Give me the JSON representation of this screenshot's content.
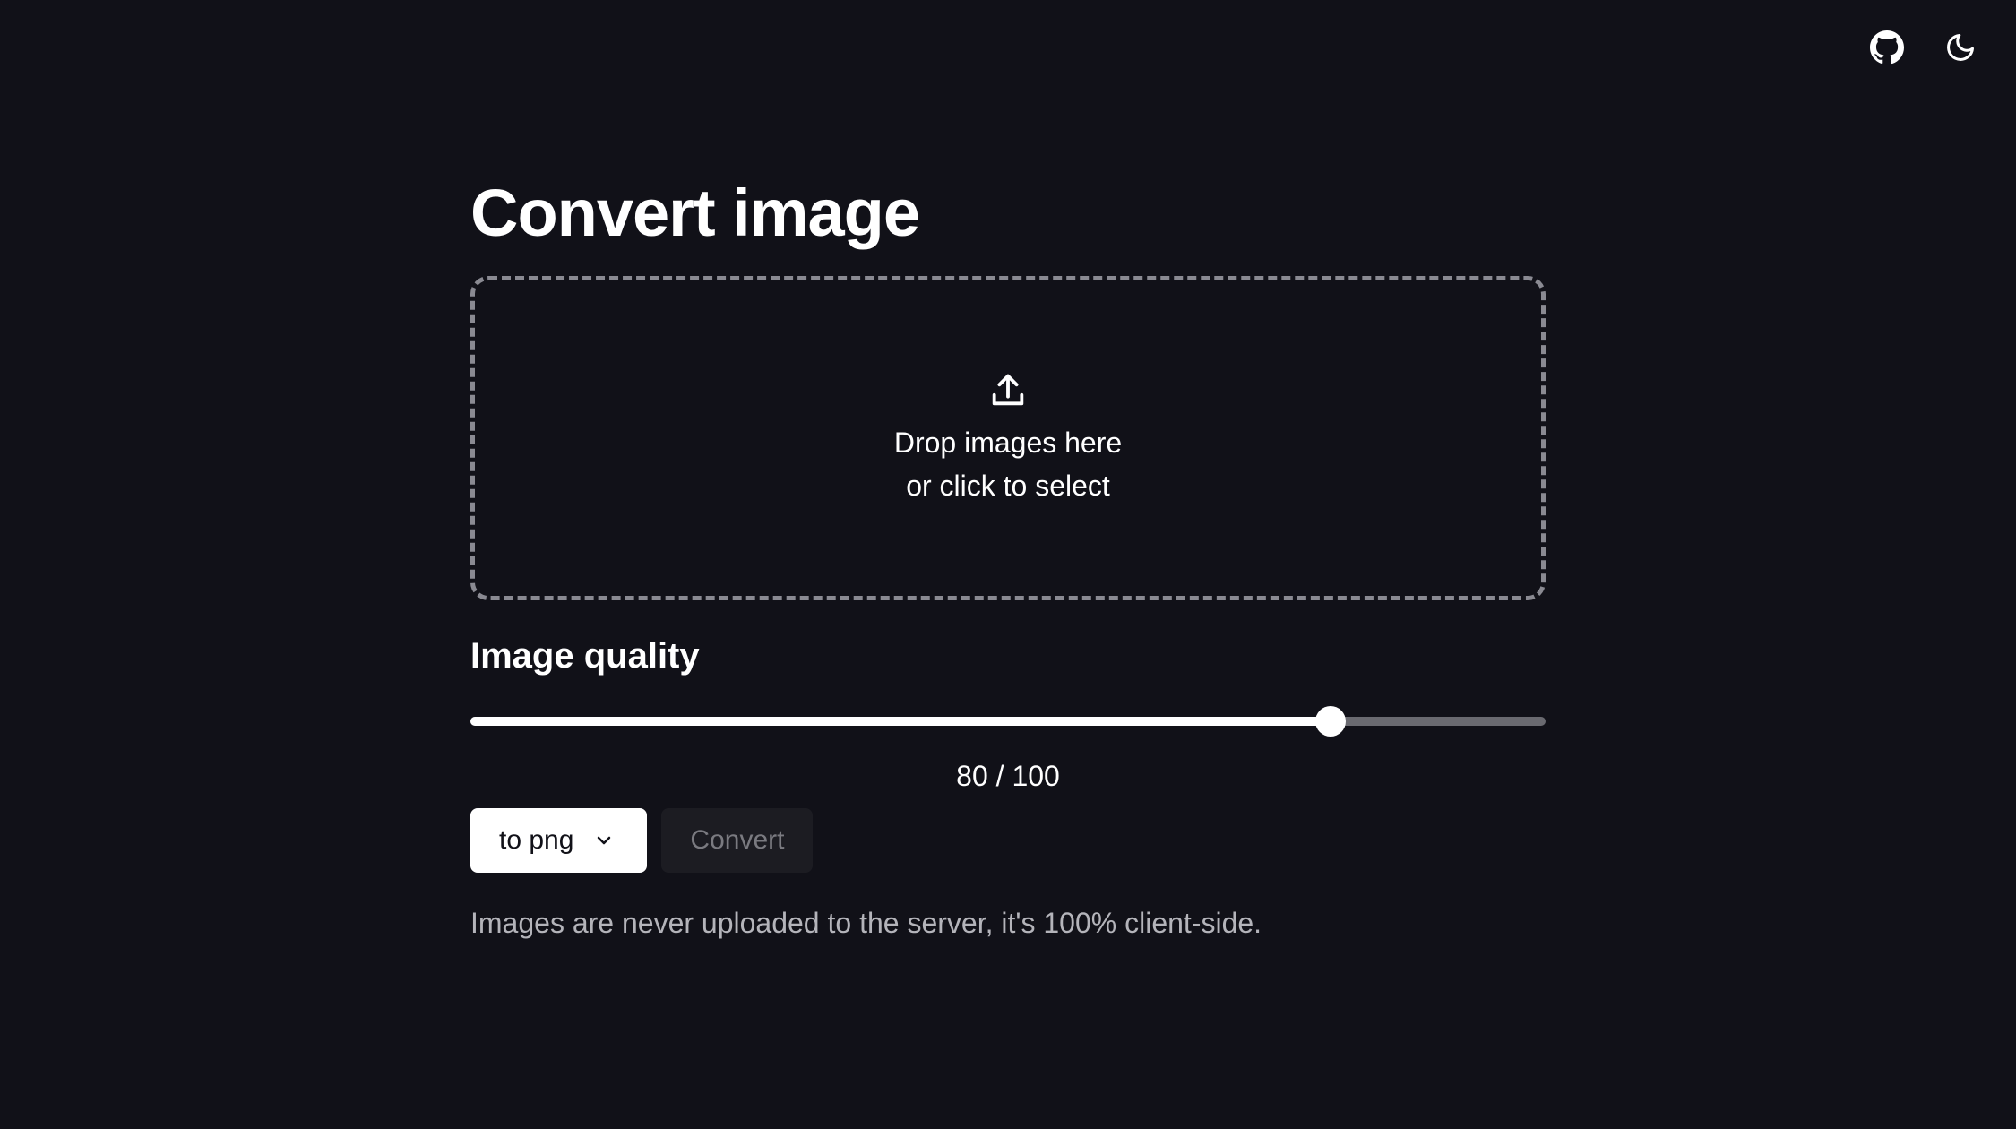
{
  "header": {
    "icons": [
      {
        "name": "github-icon"
      },
      {
        "name": "moon-icon"
      }
    ]
  },
  "main": {
    "title": "Convert image",
    "dropzone": {
      "icon": "upload-icon",
      "line1": "Drop images here",
      "line2": "or click to select"
    },
    "quality": {
      "label": "Image quality",
      "value": 80,
      "max": 100,
      "display": "80 / 100"
    },
    "format_select": {
      "selected": "to png",
      "icon": "chevron-down-icon"
    },
    "convert_button": {
      "label": "Convert",
      "disabled": true
    },
    "footnote": "Images are never uploaded to the server, it's 100% client-side."
  },
  "colors": {
    "background": "#111118",
    "text": "#ffffff",
    "muted_text": "#b4b4ba",
    "disabled_button_bg": "#1c1c22",
    "disabled_button_text": "#7a7a80",
    "slider_track": "#6a6a70"
  }
}
